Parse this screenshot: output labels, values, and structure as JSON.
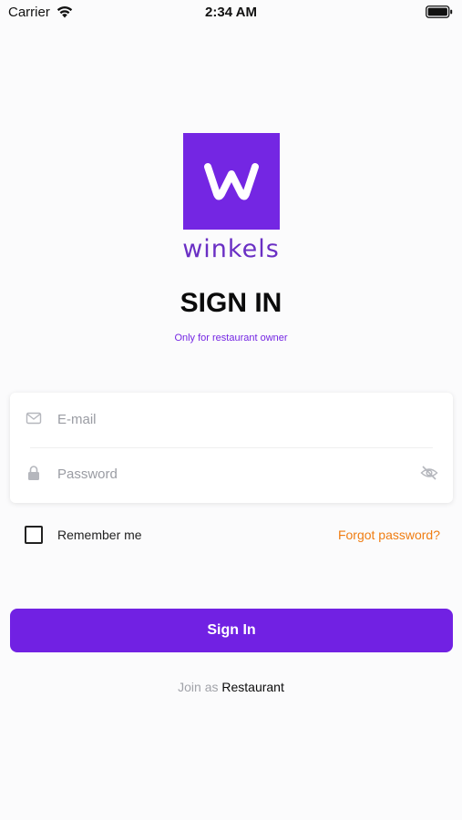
{
  "status_bar": {
    "carrier": "Carrier",
    "time": "2:34 AM"
  },
  "logo": {
    "wordmark": "winkels",
    "brand_color": "#7426e3"
  },
  "header": {
    "title": "SIGN IN",
    "subtitle": "Only for restaurant owner"
  },
  "form": {
    "email_placeholder": "E-mail",
    "email_value": "",
    "password_placeholder": "Password",
    "password_value": "",
    "remember_label": "Remember me",
    "remember_checked": false,
    "forgot_label": "Forgot password?"
  },
  "actions": {
    "signin_label": "Sign In",
    "join_prefix": "Join as",
    "join_link": "Restaurant"
  },
  "colors": {
    "accent": "#7121e3",
    "link_orange": "#f07d12"
  },
  "icons": [
    "wifi-icon",
    "battery-icon",
    "mail-icon",
    "lock-icon",
    "eye-off-icon"
  ]
}
